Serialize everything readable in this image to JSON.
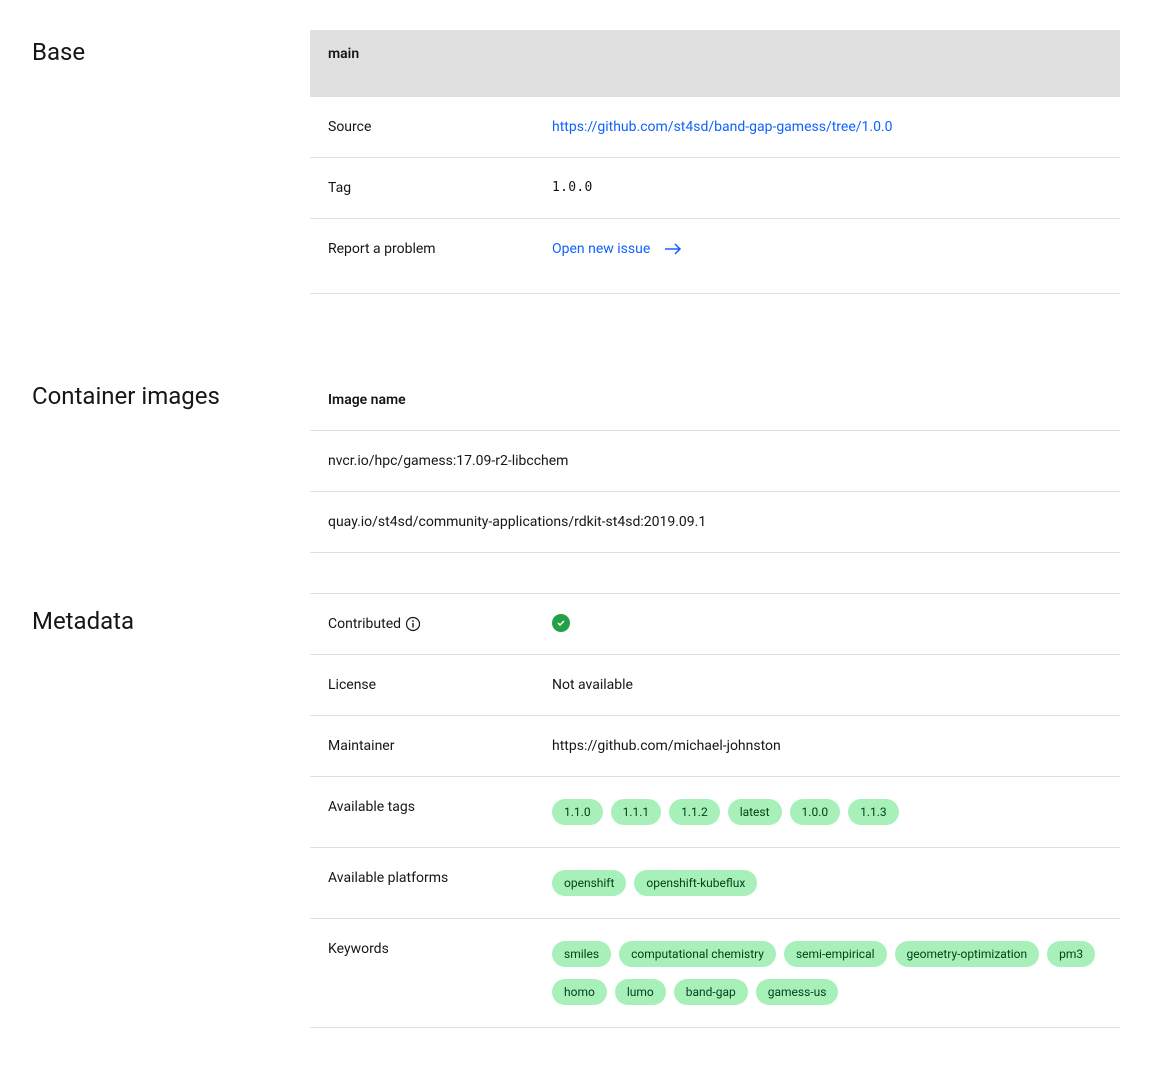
{
  "base": {
    "title": "Base",
    "header": "main",
    "source_label": "Source",
    "source_url": "https://github.com/st4sd/band-gap-gamess/tree/1.0.0",
    "tag_label": "Tag",
    "tag_value": "1.0.0",
    "report_label": "Report a problem",
    "report_link_text": "Open new issue"
  },
  "container_images": {
    "title": "Container images",
    "header": "Image name",
    "images": [
      "nvcr.io/hpc/gamess:17.09-r2-libcchem",
      "quay.io/st4sd/community-applications/rdkit-st4sd:2019.09.1"
    ]
  },
  "metadata": {
    "title": "Metadata",
    "contributed_label": "Contributed",
    "license_label": "License",
    "license_value": "Not available",
    "maintainer_label": "Maintainer",
    "maintainer_value": "https://github.com/michael-johnston",
    "available_tags_label": "Available tags",
    "available_tags": [
      "1.1.0",
      "1.1.1",
      "1.1.2",
      "latest",
      "1.0.0",
      "1.1.3"
    ],
    "available_platforms_label": "Available platforms",
    "available_platforms": [
      "openshift",
      "openshift-kubeflux"
    ],
    "keywords_label": "Keywords",
    "keywords": [
      "smiles",
      "computational chemistry",
      "semi-empirical",
      "geometry-optimization",
      "pm3",
      "homo",
      "lumo",
      "band-gap",
      "gamess-us"
    ]
  }
}
